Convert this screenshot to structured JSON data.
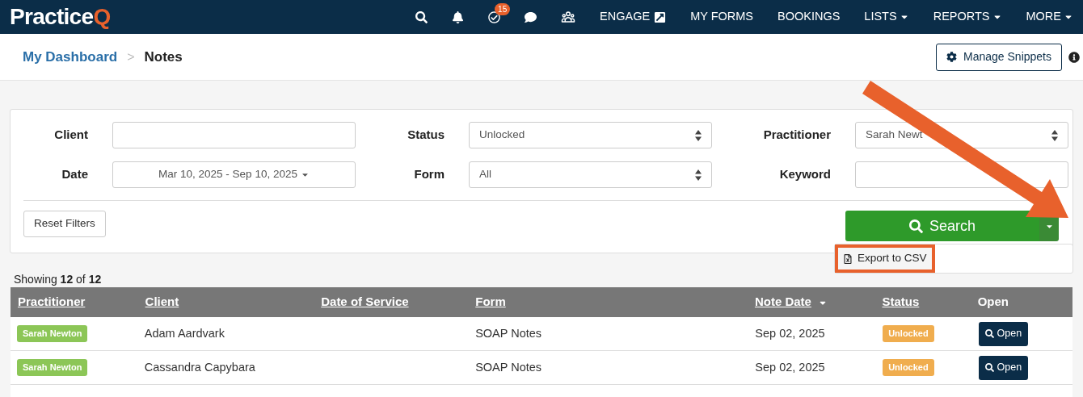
{
  "brand": "PracticeQ",
  "nav": [
    {
      "kind": "search"
    },
    {
      "kind": "bell"
    },
    {
      "kind": "tasks",
      "badge": "15"
    },
    {
      "kind": "chat"
    },
    {
      "kind": "people"
    },
    {
      "kind": "external",
      "label": "ENGAGE"
    },
    {
      "kind": "link",
      "label": "MY FORMS"
    },
    {
      "kind": "link",
      "label": "BOOKINGS"
    },
    {
      "kind": "dropdown",
      "label": "LISTS"
    },
    {
      "kind": "dropdown",
      "label": "REPORTS"
    },
    {
      "kind": "dropdown",
      "label": "MORE"
    }
  ],
  "breadcrumb": [
    {
      "label": "My Dashboard",
      "kind": "link"
    },
    {
      "label": "Notes",
      "kind": "current"
    }
  ],
  "breadcrumb_separator": ">",
  "manage_button": "Manage Snippets",
  "filters": [
    {
      "label": "Client",
      "kind": "text"
    },
    {
      "label": "Status",
      "kind": "select",
      "value": "Unlocked"
    },
    {
      "label": "Practitioner",
      "kind": "select",
      "value": "Sarah Newt"
    },
    {
      "label": "Date",
      "kind": "daterange",
      "value": "Mar 10, 2025 - Sep 10, 2025"
    },
    {
      "label": "Form",
      "kind": "select",
      "value": "All"
    },
    {
      "label": "Keyword",
      "kind": "text"
    }
  ],
  "reset_button": "Reset Filters",
  "search_button": "Search",
  "dropdown_menu": [
    {
      "label": "Export to CSV",
      "highlighted": true
    }
  ],
  "showing": "Showing **12** of **12**",
  "table": {
    "columns": [
      {
        "label": "Practitioner",
        "sortable": true,
        "sorted": false
      },
      {
        "label": "Client",
        "sortable": true,
        "sorted": false
      },
      {
        "label": "Date of Service",
        "sortable": true,
        "sorted": false
      },
      {
        "label": "Form",
        "sortable": true,
        "sorted": false
      },
      {
        "label": "Note Date",
        "sortable": true,
        "sorted": true
      },
      {
        "label": "Status",
        "sortable": true,
        "sorted": false
      },
      {
        "label": "Open",
        "sortable": false
      }
    ],
    "rows": [
      {
        "practitioner": "Sarah Newton",
        "client": "Adam Aardvark",
        "form": "SOAP Notes",
        "note_date": "Sep 02, 2025",
        "status": "Unlocked",
        "open": "Open"
      },
      {
        "practitioner": "Sarah Newton",
        "client": "Cassandra Capybara",
        "form": "SOAP Notes",
        "note_date": "Sep 02, 2025",
        "status": "Unlocked",
        "open": "Open"
      }
    ]
  }
}
